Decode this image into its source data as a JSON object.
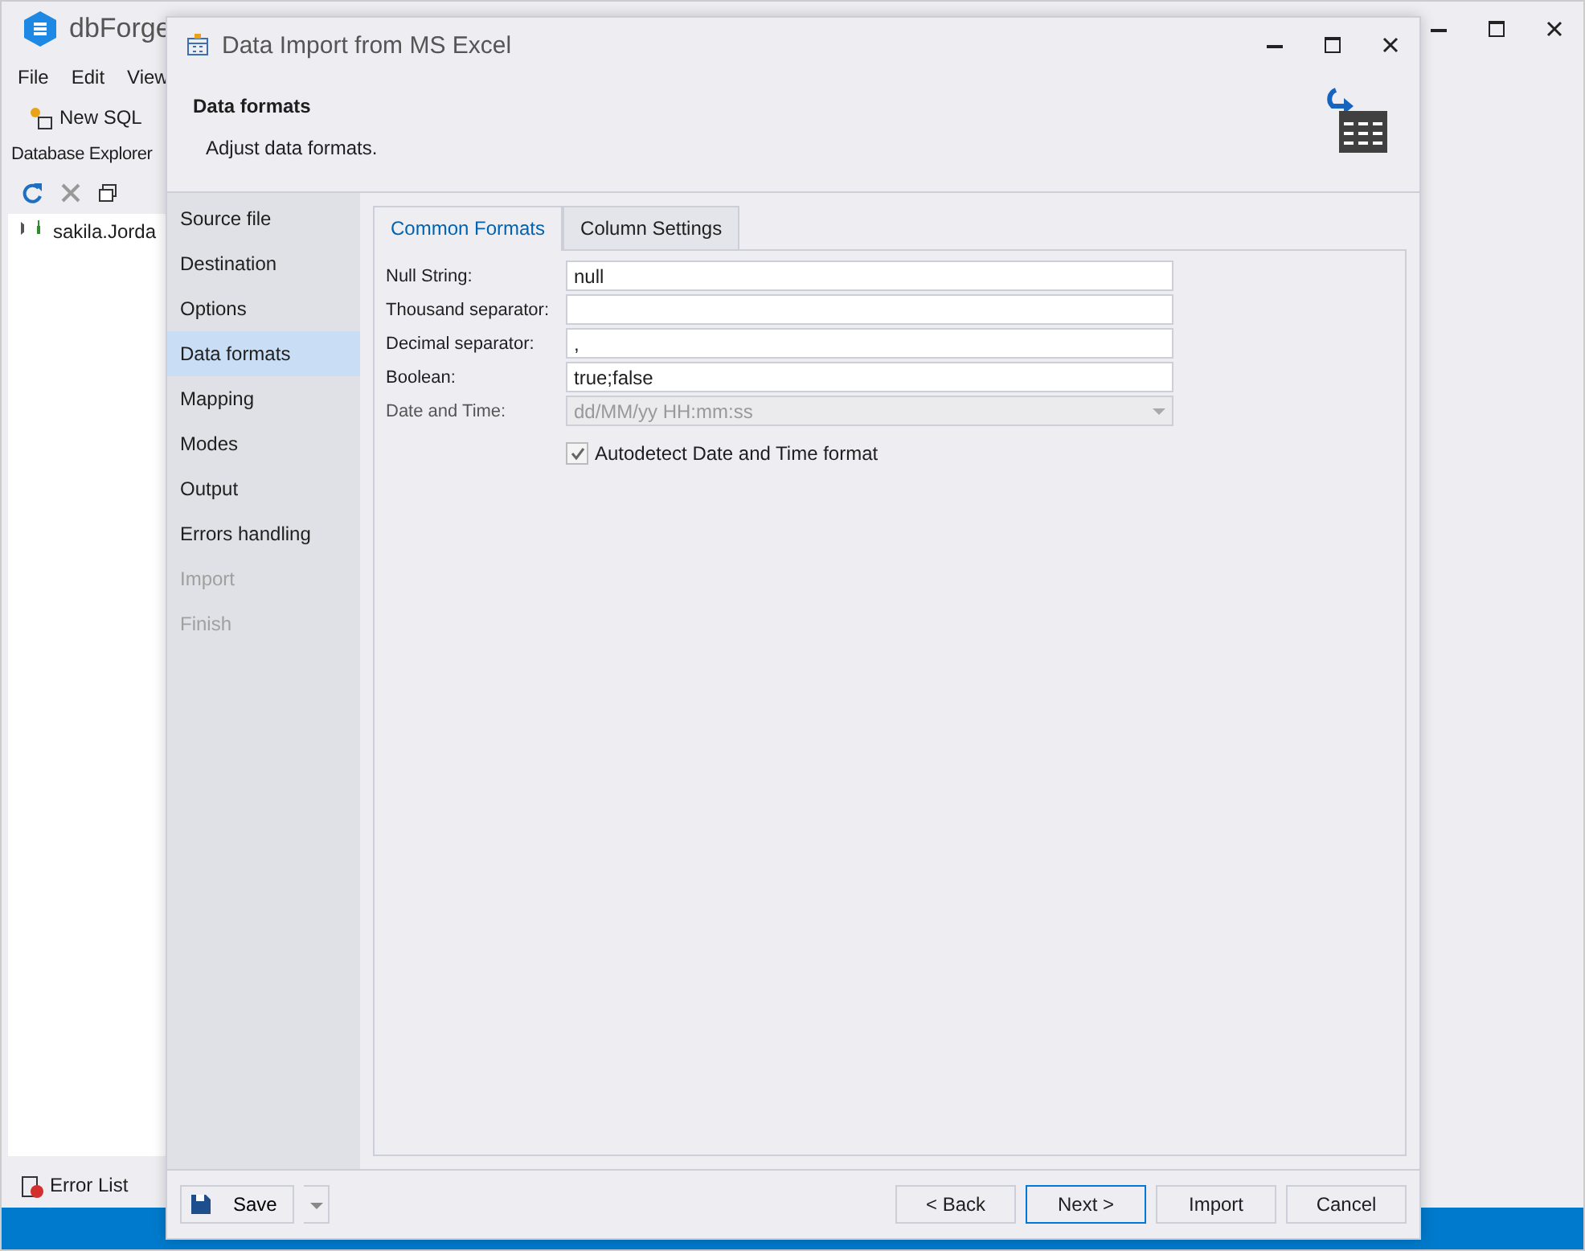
{
  "app": {
    "title": "dbForge",
    "menu": [
      "File",
      "Edit",
      "View"
    ],
    "toolbar": [
      "New SQL"
    ],
    "explorer": {
      "title": "Database Explorer",
      "items": [
        "sakila.Jorda"
      ]
    },
    "bottom_tab": "Error List"
  },
  "dialog": {
    "title": "Data Import from MS Excel",
    "header": {
      "title": "Data formats",
      "subtitle": "Adjust data formats."
    },
    "steps": [
      {
        "label": "Source file",
        "selected": false,
        "disabled": false
      },
      {
        "label": "Destination",
        "selected": false,
        "disabled": false
      },
      {
        "label": "Options",
        "selected": false,
        "disabled": false
      },
      {
        "label": "Data formats",
        "selected": true,
        "disabled": false
      },
      {
        "label": "Mapping",
        "selected": false,
        "disabled": false
      },
      {
        "label": "Modes",
        "selected": false,
        "disabled": false
      },
      {
        "label": "Output",
        "selected": false,
        "disabled": false
      },
      {
        "label": "Errors handling",
        "selected": false,
        "disabled": false
      },
      {
        "label": "Import",
        "selected": false,
        "disabled": true
      },
      {
        "label": "Finish",
        "selected": false,
        "disabled": true
      }
    ],
    "tabs": [
      {
        "label": "Common Formats",
        "selected": true
      },
      {
        "label": "Column Settings",
        "selected": false
      }
    ],
    "fields": [
      {
        "label": "Null String:",
        "value": "null",
        "kind": "text",
        "disabled": false
      },
      {
        "label": "Thousand separator:",
        "kind": "text",
        "disabled": false
      },
      {
        "label": "Decimal separator:",
        "value": ",",
        "kind": "text",
        "disabled": false
      },
      {
        "label": "Boolean:",
        "value": "true;false",
        "kind": "text",
        "disabled": false
      },
      {
        "label": "Date and Time:",
        "value": "dd/MM/yy HH:mm:ss",
        "kind": "combo",
        "disabled": true
      }
    ],
    "checkbox": {
      "label": "Autodetect Date and Time format",
      "checked": true
    },
    "save": "Save",
    "buttons": [
      {
        "label": "< Back",
        "default": false
      },
      {
        "label": "Next >",
        "default": true
      },
      {
        "label": "Import",
        "default": false
      },
      {
        "label": "Cancel",
        "default": false
      }
    ]
  }
}
